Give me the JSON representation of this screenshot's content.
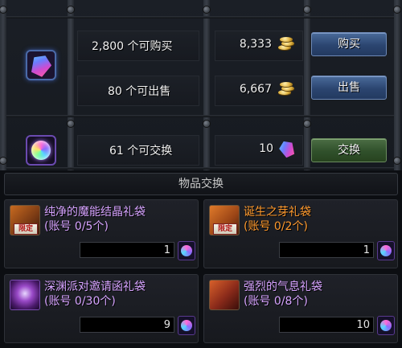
{
  "trade": {
    "buy_row": {
      "label": "2,800 个可购买",
      "price": "8,333",
      "button": "购买"
    },
    "sell_row": {
      "label": "80 个可出售",
      "price": "6,667",
      "button": "出售"
    },
    "exchange_row": {
      "label": "61 个可交换",
      "cost": "10",
      "button": "交换"
    },
    "currency_icon": "gold-coins-icon",
    "gem_icon": "crystal-gem-icon",
    "orb_icon": "rainbow-orb-icon",
    "colors": {
      "buy_button": "#2b4570",
      "exchange_button": "#30502b"
    }
  },
  "section_title": "物品交换",
  "items": [
    {
      "name": "纯净的魔能结晶礼袋",
      "limit": "(账号 0/5个)",
      "quantity": "1",
      "badge": "限定",
      "name_color": "#d6a3ff"
    },
    {
      "name": "诞生之芽礼袋",
      "limit": "(账号 0/2个)",
      "quantity": "1",
      "badge": "限定",
      "name_color": "#ff9a2e"
    },
    {
      "name": "深渊派对邀请函礼袋",
      "limit": "(账号 0/30个)",
      "quantity": "9",
      "badge": "",
      "name_color": "#d6a3ff"
    },
    {
      "name": "强烈的气息礼袋",
      "limit": "(账号 0/8个)",
      "quantity": "10",
      "badge": "",
      "name_color": "#d6a3ff"
    }
  ]
}
